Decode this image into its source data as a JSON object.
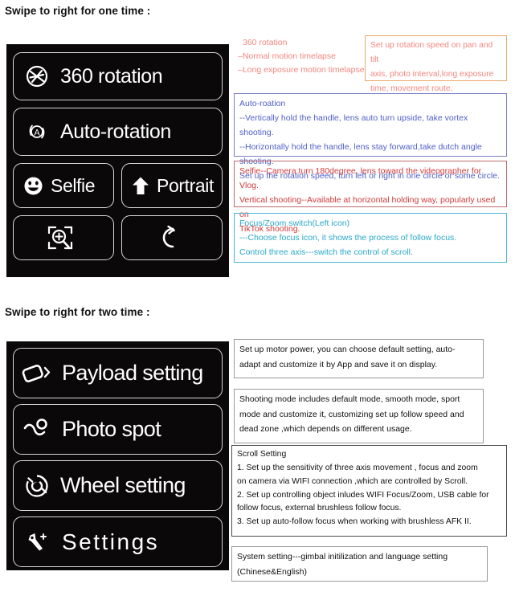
{
  "sections": [
    {
      "title": "Swipe to right for one time :",
      "buttons": [
        {
          "label": "360 rotation",
          "icon": "rotation-wheel-icon"
        },
        {
          "label": "Auto-rotation",
          "icon": "auto-rotate-a-icon"
        },
        {
          "label": "Selfie",
          "icon": "smiley-face-icon"
        },
        {
          "label": "Portrait",
          "icon": "up-arrow-icon"
        },
        {
          "label": "",
          "icon": "focus-zoom-icon"
        },
        {
          "label": "",
          "icon": "scroll-switch-icon"
        }
      ]
    },
    {
      "title": "Swipe to right for two time :",
      "buttons": [
        {
          "label": "Payload setting",
          "icon": "payload-camera-icon"
        },
        {
          "label": "Photo spot",
          "icon": "photo-spot-path-icon"
        },
        {
          "label": "Wheel setting",
          "icon": "wheel-aperture-icon"
        },
        {
          "label": "Settings",
          "icon": "wrench-icon"
        }
      ]
    }
  ],
  "annotations": {
    "red_list": {
      "line1": "360 rotation",
      "line2": "Normal  motion timelapse",
      "line3": "Long exposure motion timelapse"
    },
    "orange_box": {
      "line1": "Set up rotation speed on pan and tilt",
      "line2": "axis, photo interval,long exposure",
      "line3": "time, movement route."
    },
    "blue_auto": {
      "line1": "Auto-roation",
      "line2": "--Vertically hold the handle, lens auto turn upside, take vortex shooting.",
      "line3": "--Horizontally hold the handle, lens stay forward,take dutch angle",
      "line4": "shooting.",
      "line5": "Set up the rotation speed, turn left or right in one circle or some circle."
    },
    "red_selfie": {
      "line1": "Selfie--Camera turn 180degree, lens toward the videographer for Vlog.",
      "line2": "Vertical shooting--Available at horizontal holding way, popularly used on",
      "line3": "TikTok shooting."
    },
    "cyan_focus": {
      "line1": "Focus/Zoom switch(Left icon)",
      "line2": "---Choose focus icon, it shows the process of follow focus.",
      "line3": "Control three axis---switch the control of scroll."
    },
    "motor_box": {
      "line1": "Set up motor power, you can choose default setting, auto-",
      "line2": "adapt and customize it by App and save it on display."
    },
    "shooting_box": {
      "line1": "Shooting mode includes default mode, smooth mode, sport",
      "line2": "mode and customize it, customizing set up follow speed and",
      "line3": "dead zone ,which depends on different usage."
    },
    "scroll_box": {
      "line1": "Scroll Setting",
      "line2": "1. Set up the sensitivity of three axis movement , focus and zoom",
      "line3": "on camera via WIFI connection ,which are controlled by Scroll.",
      "line4": "2. Set up controlling object inludes WIFI Focus/Zoom, USB cable for",
      "line5": "follow focus, external brushless follow focus.",
      "line6": "3. Set up auto-follow focus when working with brushless AFK II."
    },
    "system_box": {
      "line1": "System setting---gimbal initilization and language setting",
      "line2": "(Chinese&English)"
    }
  },
  "colors": {
    "panel_bg": "#0a0808",
    "button_border": "#d8d8d8",
    "red": "#d23a3a",
    "salmon": "#f4877f",
    "blue": "#4f5fc9",
    "cyan": "#2aa8c9",
    "orange_border": "#e8a96a"
  }
}
